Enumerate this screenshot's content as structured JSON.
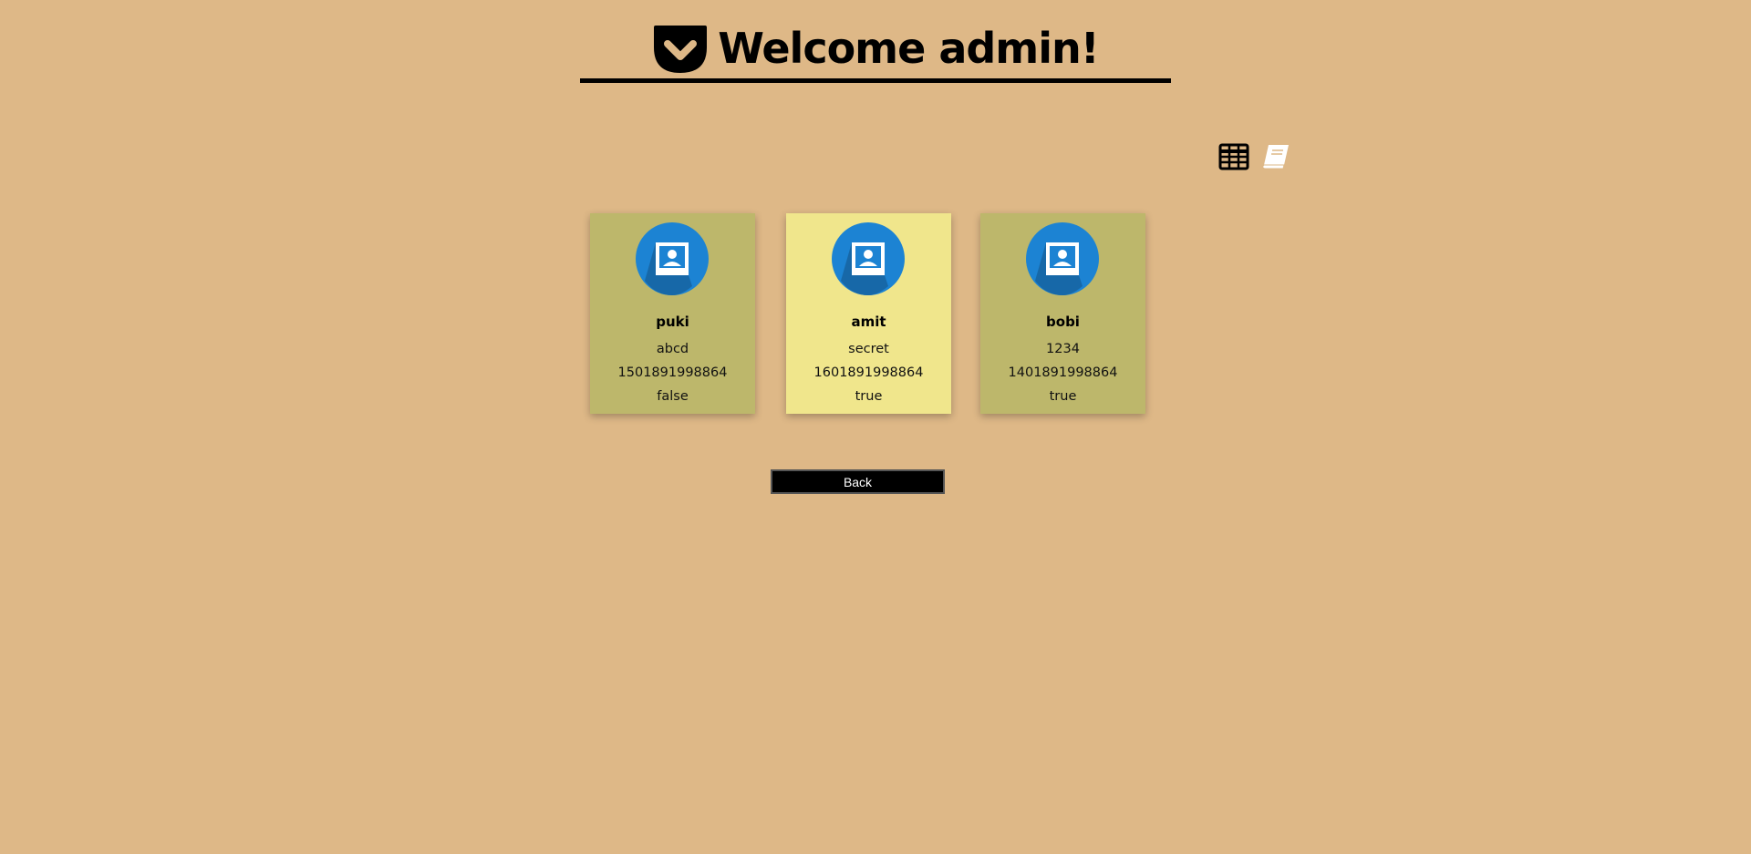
{
  "header": {
    "title": "Welcome admin!",
    "logo_icon": "pocket-icon"
  },
  "view_toggle": {
    "table_icon": "table-grid-icon",
    "cards_icon": "book-icon",
    "active": "cards"
  },
  "users": [
    {
      "name": "puki",
      "password": "abcd",
      "timestamp": "1501891998864",
      "is_admin": "false",
      "active": false
    },
    {
      "name": "amit",
      "password": "secret",
      "timestamp": "1601891998864",
      "is_admin": "true",
      "active": true
    },
    {
      "name": "bobi",
      "password": "1234",
      "timestamp": "1401891998864",
      "is_admin": "true",
      "active": false
    }
  ],
  "back_button": {
    "label": "Back"
  },
  "colors": {
    "background": "#deb887",
    "card": "#bdb76b",
    "card_active": "#f0e68c",
    "avatar": "#1c83d3"
  }
}
